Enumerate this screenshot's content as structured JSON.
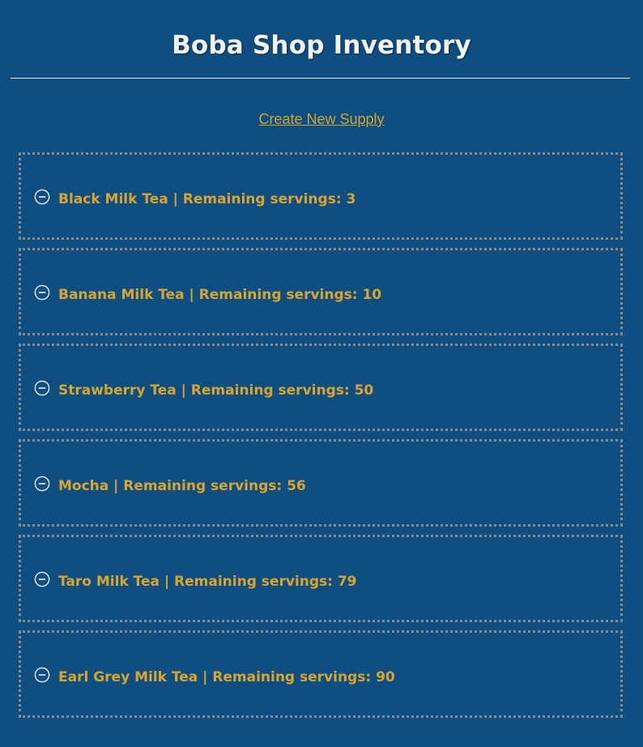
{
  "header": {
    "title": "Boba Shop Inventory"
  },
  "actions": {
    "create_label": "Create New Supply"
  },
  "supplies": [
    {
      "label": "Black Milk Tea | Remaining servings: 3",
      "icon": "minus-circle-icon"
    },
    {
      "label": "Banana Milk Tea | Remaining servings: 10",
      "icon": "minus-circle-icon"
    },
    {
      "label": "Strawberry Tea | Remaining servings: 50",
      "icon": "minus-circle-icon"
    },
    {
      "label": "Mocha | Remaining servings: 56",
      "icon": "minus-circle-icon"
    },
    {
      "label": "Taro Milk Tea | Remaining servings: 79",
      "icon": "minus-circle-icon"
    },
    {
      "label": "Earl Grey Milk Tea | Remaining servings: 90",
      "icon": "minus-circle-icon"
    }
  ],
  "colors": {
    "background": "#0f4e80",
    "accent": "#d7a530",
    "title": "#f3f3f3",
    "border": "#8a8a8a"
  }
}
